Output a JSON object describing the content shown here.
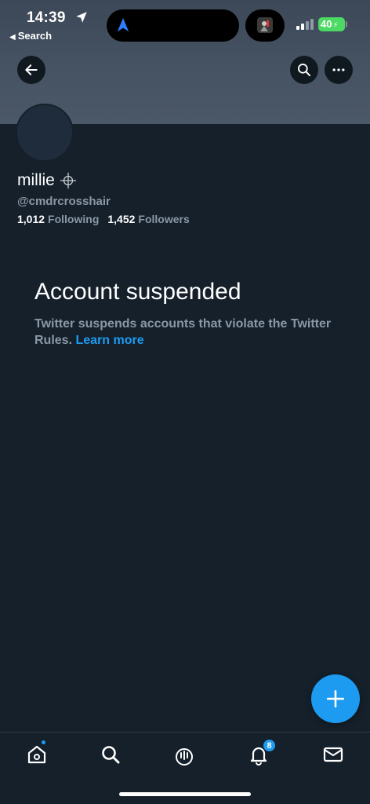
{
  "status_bar": {
    "time": "14:39",
    "back_app": "Search",
    "battery": "40"
  },
  "profile": {
    "display_name": "millie",
    "handle": "@cmdrcrosshair",
    "following_count": "1,012",
    "following_label": "Following",
    "followers_count": "1,452",
    "followers_label": "Followers"
  },
  "notice": {
    "title": "Account suspended",
    "text": "Twitter suspends accounts that violate the Twitter Rules.",
    "link": "Learn more"
  },
  "nav": {
    "notifications_badge": "8"
  },
  "colors": {
    "background": "#15202b",
    "accent": "#1d9bf0",
    "muted_text": "#8b98a5",
    "battery": "#4cd964"
  },
  "icons": [
    "back-arrow-icon",
    "search-icon",
    "more-icon",
    "crosshair-icon",
    "plus-icon",
    "home-icon",
    "explore-icon",
    "spaces-icon",
    "bell-icon",
    "mail-icon"
  ]
}
